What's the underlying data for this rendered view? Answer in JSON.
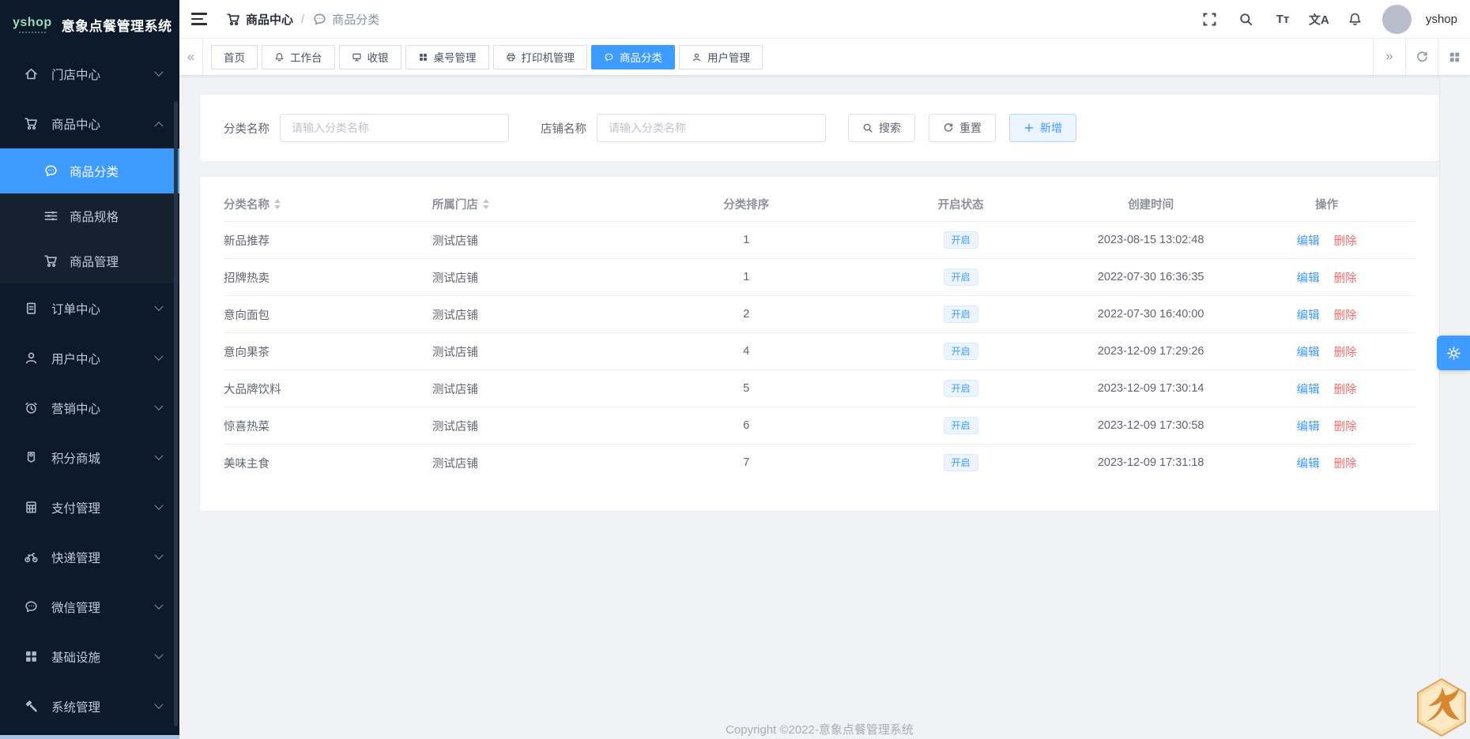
{
  "app": {
    "logo_text": "yshop",
    "title": "意象点餐管理系统"
  },
  "header": {
    "breadcrumb": {
      "root": "商品中心",
      "root_icon": "cart-icon",
      "separator": "/",
      "leaf": "商品分类",
      "leaf_icon": "chat-icon"
    },
    "icons": [
      {
        "name": "fullscreen-icon"
      },
      {
        "name": "search-icon"
      },
      {
        "name": "font-size-icon",
        "text": "Tт"
      },
      {
        "name": "translate-icon",
        "text": "文A"
      },
      {
        "name": "bell-icon"
      }
    ],
    "user_name": "yshop"
  },
  "sidebar": {
    "items": [
      {
        "label": "门店中心",
        "icon": "home-icon",
        "expanded": false
      },
      {
        "label": "商品中心",
        "icon": "cart-icon",
        "expanded": true,
        "children": [
          {
            "label": "商品分类",
            "icon": "chat-icon",
            "active": true
          },
          {
            "label": "商品规格",
            "icon": "sliders-icon",
            "active": false
          },
          {
            "label": "商品管理",
            "icon": "cart-icon",
            "active": false
          }
        ]
      },
      {
        "label": "订单中心",
        "icon": "clipboard-icon",
        "expanded": false
      },
      {
        "label": "用户中心",
        "icon": "user-icon",
        "expanded": false
      },
      {
        "label": "营销中心",
        "icon": "alarm-icon",
        "expanded": false
      },
      {
        "label": "积分商城",
        "icon": "medal-icon",
        "expanded": false
      },
      {
        "label": "支付管理",
        "icon": "calculator-icon",
        "expanded": false
      },
      {
        "label": "快递管理",
        "icon": "bike-icon",
        "expanded": false
      },
      {
        "label": "微信管理",
        "icon": "chat-icon",
        "expanded": false
      },
      {
        "label": "基础设施",
        "icon": "grid-icon",
        "expanded": false
      },
      {
        "label": "系统管理",
        "icon": "hammer-icon",
        "expanded": false
      }
    ]
  },
  "tabbar": {
    "tabs": [
      {
        "label": "首页",
        "icon": "",
        "active": false
      },
      {
        "label": "工作台",
        "icon": "bell-icon",
        "active": false
      },
      {
        "label": "收银",
        "icon": "monitor-icon",
        "active": false
      },
      {
        "label": "桌号管理",
        "icon": "grid-icon",
        "active": false
      },
      {
        "label": "打印机管理",
        "icon": "printer-icon",
        "active": false
      },
      {
        "label": "商品分类",
        "icon": "chat-icon",
        "active": true
      },
      {
        "label": "用户管理",
        "icon": "user-icon",
        "active": false
      }
    ],
    "controls": {
      "prev": "«",
      "next": "»"
    }
  },
  "filters": {
    "category_label": "分类名称",
    "category_placeholder": "请输入分类名称",
    "category_value": "",
    "shop_label": "店铺名称",
    "shop_placeholder": "请输入分类名称",
    "shop_value": "",
    "search_label": "搜索",
    "reset_label": "重置",
    "add_label": "新增"
  },
  "table": {
    "columns": [
      {
        "label": "分类名称",
        "sortable": true
      },
      {
        "label": "所属门店",
        "sortable": true
      },
      {
        "label": "分类排序",
        "sortable": false
      },
      {
        "label": "开启状态",
        "sortable": false
      },
      {
        "label": "创建时间",
        "sortable": false
      },
      {
        "label": "操作",
        "sortable": false
      }
    ],
    "edit_label": "编辑",
    "delete_label": "删除",
    "rows": [
      {
        "name": "新品推荐",
        "shop": "测试店铺",
        "sort": "1",
        "status": "开启",
        "created": "2023-08-15 13:02:48"
      },
      {
        "name": "招牌热卖",
        "shop": "测试店铺",
        "sort": "1",
        "status": "开启",
        "created": "2022-07-30 16:36:35"
      },
      {
        "name": "意向面包",
        "shop": "测试店铺",
        "sort": "2",
        "status": "开启",
        "created": "2022-07-30 16:40:00"
      },
      {
        "name": "意向果茶",
        "shop": "测试店铺",
        "sort": "4",
        "status": "开启",
        "created": "2023-12-09 17:29:26"
      },
      {
        "name": "大品牌饮料",
        "shop": "测试店铺",
        "sort": "5",
        "status": "开启",
        "created": "2023-12-09 17:30:14"
      },
      {
        "name": "惊喜热菜",
        "shop": "测试店铺",
        "sort": "6",
        "status": "开启",
        "created": "2023-12-09 17:30:58"
      },
      {
        "name": "美味主食",
        "shop": "测试店铺",
        "sort": "7",
        "status": "开启",
        "created": "2023-12-09 17:31:18"
      }
    ]
  },
  "footer": {
    "copyright": "Copyright ©2022-意象点餐管理系统"
  },
  "colors": {
    "accent": "#3e9bff",
    "danger": "#f56c6c",
    "sidebar_bg": "#0c1a2c",
    "submenu_bg": "#16212f",
    "content_bg": "#f0f2f5",
    "tag_bg": "#ecf5ff",
    "tag_border": "#d9ecff",
    "add_btn_bg": "#ecf5ff"
  }
}
